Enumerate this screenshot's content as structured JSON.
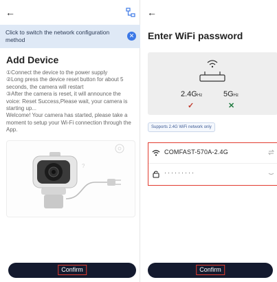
{
  "left": {
    "back_glyph": "←",
    "banner_text": "Click to switch the network configuration method",
    "banner_close": "✕",
    "title": "Add Device",
    "instructions": [
      "①Connect the device to the power supply",
      "②Long press the device reset button for about 5 seconds, the camera will restart",
      "③After the camera is reset, it will announce the voice: Reset Success,Please wait, your camera is starting up...",
      "Welcome! Your camera has started, please take a moment to setup your Wi-Fi connection through the App."
    ],
    "confirm_label": "Confirm"
  },
  "right": {
    "back_glyph": "←",
    "title": "Enter WiFi password",
    "band_24": "2.4G",
    "band_5": "5G",
    "band_unit": "Hz",
    "band_24_mark": "✓",
    "band_5_mark": "✕",
    "support_text": "Supports 2.4G WiFi network only",
    "ssid": "COMFAST-570A-2.4G",
    "password_mask": "·········",
    "confirm_label": "Confirm"
  },
  "colors": {
    "accent_blue": "#3b78e7",
    "banner_bg": "#dfe9f6",
    "button_dark": "#141a2e",
    "highlight_red": "#e23b2e",
    "check_red": "#c0392b",
    "cross_green": "#1f7a3f"
  },
  "icons": {
    "back": "arrow-left-icon",
    "switch_network": "network-switch-icon",
    "close": "close-icon",
    "router": "router-icon",
    "wifi": "wifi-icon",
    "lock": "lock-icon",
    "swap": "swap-icon",
    "eye": "eye-closed-icon",
    "camera": "camera-icon"
  }
}
